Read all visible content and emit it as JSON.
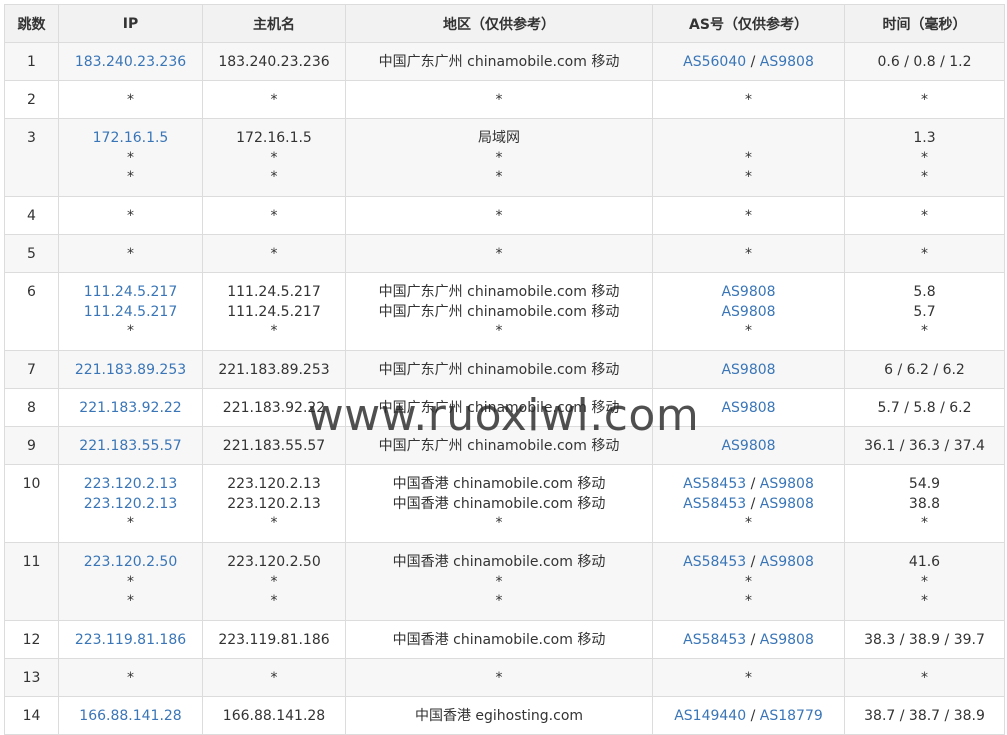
{
  "headers": [
    "跳数",
    "IP",
    "主机名",
    "地区（仅供参考）",
    "AS号（仅供参考）",
    "时间（毫秒）"
  ],
  "rows": [
    {
      "hop": "1",
      "ip": [
        "183.240.23.236"
      ],
      "host": [
        "183.240.23.236"
      ],
      "region": [
        "中国广东广州 chinamobile.com 移动"
      ],
      "as": [
        [
          "AS56040",
          "AS9808"
        ]
      ],
      "time": [
        "0.6 / 0.8 / 1.2"
      ]
    },
    {
      "hop": "2",
      "ip": [
        "*"
      ],
      "host": [
        "*"
      ],
      "region": [
        "*"
      ],
      "as": [
        [
          "*"
        ]
      ],
      "time": [
        "*"
      ]
    },
    {
      "hop": "3",
      "ip": [
        "172.16.1.5",
        "*",
        "*"
      ],
      "host": [
        "172.16.1.5",
        "*",
        "*"
      ],
      "region": [
        "局域网",
        "*",
        "*"
      ],
      "as": [
        [
          ""
        ],
        [
          "*"
        ],
        [
          "*"
        ]
      ],
      "time": [
        "1.3",
        "*",
        "*"
      ]
    },
    {
      "hop": "4",
      "ip": [
        "*"
      ],
      "host": [
        "*"
      ],
      "region": [
        "*"
      ],
      "as": [
        [
          "*"
        ]
      ],
      "time": [
        "*"
      ]
    },
    {
      "hop": "5",
      "ip": [
        "*"
      ],
      "host": [
        "*"
      ],
      "region": [
        "*"
      ],
      "as": [
        [
          "*"
        ]
      ],
      "time": [
        "*"
      ]
    },
    {
      "hop": "6",
      "ip": [
        "111.24.5.217",
        "111.24.5.217",
        "*"
      ],
      "host": [
        "111.24.5.217",
        "111.24.5.217",
        "*"
      ],
      "region": [
        "中国广东广州 chinamobile.com 移动",
        "中国广东广州 chinamobile.com 移动",
        "*"
      ],
      "as": [
        [
          "AS9808"
        ],
        [
          "AS9808"
        ],
        [
          "*"
        ]
      ],
      "time": [
        "5.8",
        "5.7",
        "*"
      ]
    },
    {
      "hop": "7",
      "ip": [
        "221.183.89.253"
      ],
      "host": [
        "221.183.89.253"
      ],
      "region": [
        "中国广东广州 chinamobile.com 移动"
      ],
      "as": [
        [
          "AS9808"
        ]
      ],
      "time": [
        "6 / 6.2 / 6.2"
      ]
    },
    {
      "hop": "8",
      "ip": [
        "221.183.92.22"
      ],
      "host": [
        "221.183.92.22"
      ],
      "region": [
        "中国广东广州 chinamobile.com 移动"
      ],
      "as": [
        [
          "AS9808"
        ]
      ],
      "time": [
        "5.7 / 5.8 / 6.2"
      ]
    },
    {
      "hop": "9",
      "ip": [
        "221.183.55.57"
      ],
      "host": [
        "221.183.55.57"
      ],
      "region": [
        "中国广东广州 chinamobile.com 移动"
      ],
      "as": [
        [
          "AS9808"
        ]
      ],
      "time": [
        "36.1 / 36.3 / 37.4"
      ]
    },
    {
      "hop": "10",
      "ip": [
        "223.120.2.13",
        "223.120.2.13",
        "*"
      ],
      "host": [
        "223.120.2.13",
        "223.120.2.13",
        "*"
      ],
      "region": [
        "中国香港 chinamobile.com 移动",
        "中国香港 chinamobile.com 移动",
        "*"
      ],
      "as": [
        [
          "AS58453",
          "AS9808"
        ],
        [
          "AS58453",
          "AS9808"
        ],
        [
          "*"
        ]
      ],
      "time": [
        "54.9",
        "38.8",
        "*"
      ]
    },
    {
      "hop": "11",
      "ip": [
        "223.120.2.50",
        "*",
        "*"
      ],
      "host": [
        "223.120.2.50",
        "*",
        "*"
      ],
      "region": [
        "中国香港 chinamobile.com 移动",
        "*",
        "*"
      ],
      "as": [
        [
          "AS58453",
          "AS9808"
        ],
        [
          "*"
        ],
        [
          "*"
        ]
      ],
      "time": [
        "41.6",
        "*",
        "*"
      ]
    },
    {
      "hop": "12",
      "ip": [
        "223.119.81.186"
      ],
      "host": [
        "223.119.81.186"
      ],
      "region": [
        "中国香港 chinamobile.com 移动"
      ],
      "as": [
        [
          "AS58453",
          "AS9808"
        ]
      ],
      "time": [
        "38.3 / 38.9 / 39.7"
      ]
    },
    {
      "hop": "13",
      "ip": [
        "*"
      ],
      "host": [
        "*"
      ],
      "region": [
        "*"
      ],
      "as": [
        [
          "*"
        ]
      ],
      "time": [
        "*"
      ]
    },
    {
      "hop": "14",
      "ip": [
        "166.88.141.28"
      ],
      "host": [
        "166.88.141.28"
      ],
      "region": [
        "中国香港 egihosting.com"
      ],
      "as": [
        [
          "AS149440",
          "AS18779"
        ]
      ],
      "time": [
        "38.7 / 38.7 / 38.9"
      ]
    }
  ],
  "watermark": "www.ruoxiwl.com",
  "colors": {
    "link": "#3a76b7",
    "header_bg": "#f2f2f2",
    "stripe_bg": "#f7f7f7",
    "border": "#dcdcdc"
  }
}
